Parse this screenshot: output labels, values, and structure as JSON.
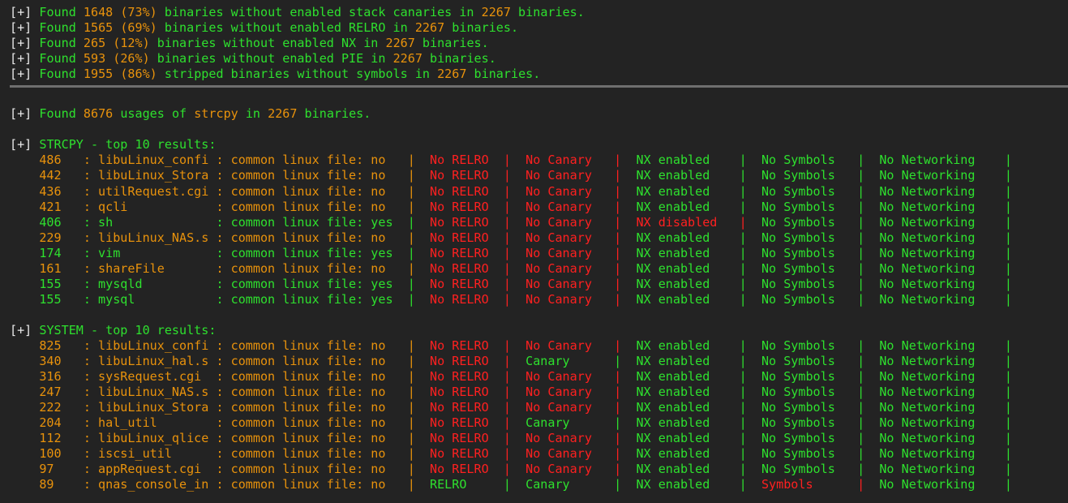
{
  "terminal": {
    "background": "#232323",
    "colors": {
      "white": "#e8e8e8",
      "green": "#2ee02e",
      "orange": "#e8920c",
      "red": "#fe2020",
      "rule": "#6f6f6f"
    },
    "prefix": "[+]",
    "total_binaries": 2267,
    "summary_lines": [
      {
        "verb": "Found",
        "count": "1648",
        "percent": "(73%)",
        "text_before": "binaries without enabled stack canaries in",
        "total": "2267",
        "text_after": "binaries."
      },
      {
        "verb": "Found",
        "count": "1565",
        "percent": "(69%)",
        "text_before": "binaries without enabled RELRO in",
        "total": "2267",
        "text_after": "binaries."
      },
      {
        "verb": "Found",
        "count": "265",
        "percent": "(12%)",
        "text_before": "binaries without enabled NX in",
        "total": "2267",
        "text_after": "binaries."
      },
      {
        "verb": "Found",
        "count": "593",
        "percent": "(26%)",
        "text_before": "binaries without enabled PIE in",
        "total": "2267",
        "text_after": "binaries."
      },
      {
        "verb": "Found",
        "count": "1955",
        "percent": "(86%)",
        "text_before": "stripped binaries without symbols in",
        "total": "2267",
        "text_after": "binaries."
      }
    ],
    "usage_line": {
      "verb": "Found",
      "count": "8676",
      "text_before": "usages of",
      "function": "strcpy",
      "text_middle": "in",
      "total": "2267",
      "text_after": "binaries."
    },
    "sections": [
      {
        "heading": "STRCPY - top 10 results:",
        "rows": [
          {
            "count": "486",
            "name": "libuLinux_confi",
            "common": "no",
            "relro": "No RELRO",
            "canary": "No Canary",
            "nx": "NX enabled",
            "symbols": "No Symbols",
            "net": "No Networking"
          },
          {
            "count": "442",
            "name": "libuLinux_Stora",
            "common": "no",
            "relro": "No RELRO",
            "canary": "No Canary",
            "nx": "NX enabled",
            "symbols": "No Symbols",
            "net": "No Networking"
          },
          {
            "count": "436",
            "name": "utilRequest.cgi",
            "common": "no",
            "relro": "No RELRO",
            "canary": "No Canary",
            "nx": "NX enabled",
            "symbols": "No Symbols",
            "net": "No Networking"
          },
          {
            "count": "421",
            "name": "qcli",
            "common": "no",
            "relro": "No RELRO",
            "canary": "No Canary",
            "nx": "NX enabled",
            "symbols": "No Symbols",
            "net": "No Networking"
          },
          {
            "count": "406",
            "name": "sh",
            "common": "yes",
            "relro": "No RELRO",
            "canary": "No Canary",
            "nx": "NX disabled",
            "symbols": "No Symbols",
            "net": "No Networking"
          },
          {
            "count": "229",
            "name": "libuLinux_NAS.s",
            "common": "no",
            "relro": "No RELRO",
            "canary": "No Canary",
            "nx": "NX enabled",
            "symbols": "No Symbols",
            "net": "No Networking"
          },
          {
            "count": "174",
            "name": "vim",
            "common": "yes",
            "relro": "No RELRO",
            "canary": "No Canary",
            "nx": "NX enabled",
            "symbols": "No Symbols",
            "net": "No Networking"
          },
          {
            "count": "161",
            "name": "shareFile",
            "common": "no",
            "relro": "No RELRO",
            "canary": "No Canary",
            "nx": "NX enabled",
            "symbols": "No Symbols",
            "net": "No Networking"
          },
          {
            "count": "155",
            "name": "mysqld",
            "common": "yes",
            "relro": "No RELRO",
            "canary": "No Canary",
            "nx": "NX enabled",
            "symbols": "No Symbols",
            "net": "No Networking"
          },
          {
            "count": "155",
            "name": "mysql",
            "common": "yes",
            "relro": "No RELRO",
            "canary": "No Canary",
            "nx": "NX enabled",
            "symbols": "No Symbols",
            "net": "No Networking"
          }
        ]
      },
      {
        "heading": "SYSTEM - top 10 results:",
        "rows": [
          {
            "count": "825",
            "name": "libuLinux_confi",
            "common": "no",
            "relro": "No RELRO",
            "canary": "No Canary",
            "nx": "NX enabled",
            "symbols": "No Symbols",
            "net": "No Networking"
          },
          {
            "count": "340",
            "name": "libuLinux_hal.s",
            "common": "no",
            "relro": "No RELRO",
            "canary": "Canary",
            "nx": "NX enabled",
            "symbols": "No Symbols",
            "net": "No Networking"
          },
          {
            "count": "316",
            "name": "sysRequest.cgi",
            "common": "no",
            "relro": "No RELRO",
            "canary": "No Canary",
            "nx": "NX enabled",
            "symbols": "No Symbols",
            "net": "No Networking"
          },
          {
            "count": "247",
            "name": "libuLinux_NAS.s",
            "common": "no",
            "relro": "No RELRO",
            "canary": "No Canary",
            "nx": "NX enabled",
            "symbols": "No Symbols",
            "net": "No Networking"
          },
          {
            "count": "222",
            "name": "libuLinux_Stora",
            "common": "no",
            "relro": "No RELRO",
            "canary": "No Canary",
            "nx": "NX enabled",
            "symbols": "No Symbols",
            "net": "No Networking"
          },
          {
            "count": "204",
            "name": "hal_util",
            "common": "no",
            "relro": "No RELRO",
            "canary": "Canary",
            "nx": "NX enabled",
            "symbols": "No Symbols",
            "net": "No Networking"
          },
          {
            "count": "112",
            "name": "libuLinux_qlice",
            "common": "no",
            "relro": "No RELRO",
            "canary": "No Canary",
            "nx": "NX enabled",
            "symbols": "No Symbols",
            "net": "No Networking"
          },
          {
            "count": "100",
            "name": "iscsi_util",
            "common": "no",
            "relro": "No RELRO",
            "canary": "No Canary",
            "nx": "NX enabled",
            "symbols": "No Symbols",
            "net": "No Networking"
          },
          {
            "count": "97",
            "name": "appRequest.cgi",
            "common": "no",
            "relro": "No RELRO",
            "canary": "No Canary",
            "nx": "NX enabled",
            "symbols": "No Symbols",
            "net": "No Networking"
          },
          {
            "count": "89",
            "name": "qnas_console_in",
            "common": "no",
            "relro": "RELRO",
            "canary": "Canary",
            "nx": "NX enabled",
            "symbols": "Symbols",
            "net": "No Networking"
          }
        ]
      }
    ],
    "labels": {
      "common_prefix": "common linux file:",
      "separator": "|",
      "colon": ":"
    }
  }
}
